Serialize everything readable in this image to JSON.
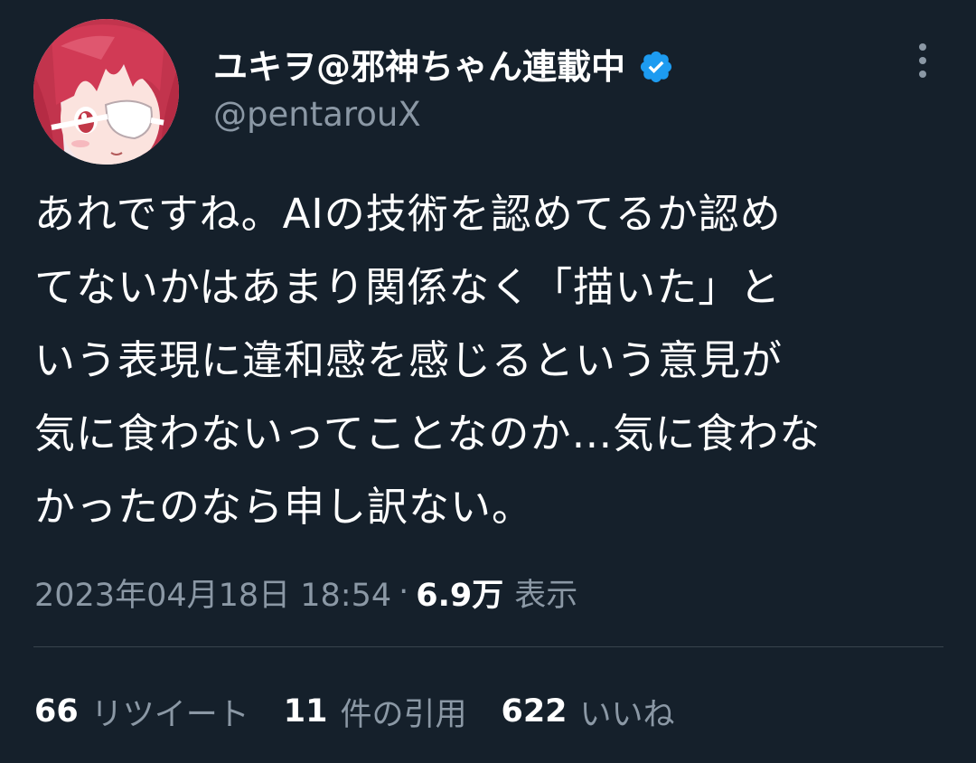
{
  "author": {
    "display_name": "ユキヲ@邪神ちゃん連載中",
    "handle": "@pentarouX",
    "verified": true,
    "verified_icon": "verified-badge-icon",
    "avatar": "anime-girl-avatar-red-hair-eyepatch"
  },
  "menu": {
    "more_icon": "more-vertical-icon"
  },
  "tweet": {
    "text_lines": [
      "あれですね。AIの技術を認めてるか認め",
      "てないかはあまり関係なく「描いた」と",
      "いう表現に違和感を感じるという意見が",
      "気に食わないってことなのか…気に食わな",
      "かったのなら申し訳ない。"
    ],
    "timestamp": "2023年04月18日 18:54",
    "separator": "·",
    "views_count": "6.9万",
    "views_label": "表示"
  },
  "stats": {
    "retweets_count": "66",
    "retweets_label": "リツイート",
    "quotes_count": "11",
    "quotes_label": "件の引用",
    "likes_count": "622",
    "likes_label": "いいね"
  },
  "colors": {
    "background": "#15202b",
    "text_primary": "#ffffff",
    "text_secondary": "#8b98a5",
    "divider": "#38444d",
    "verified_blue": "#1d9bf0"
  }
}
